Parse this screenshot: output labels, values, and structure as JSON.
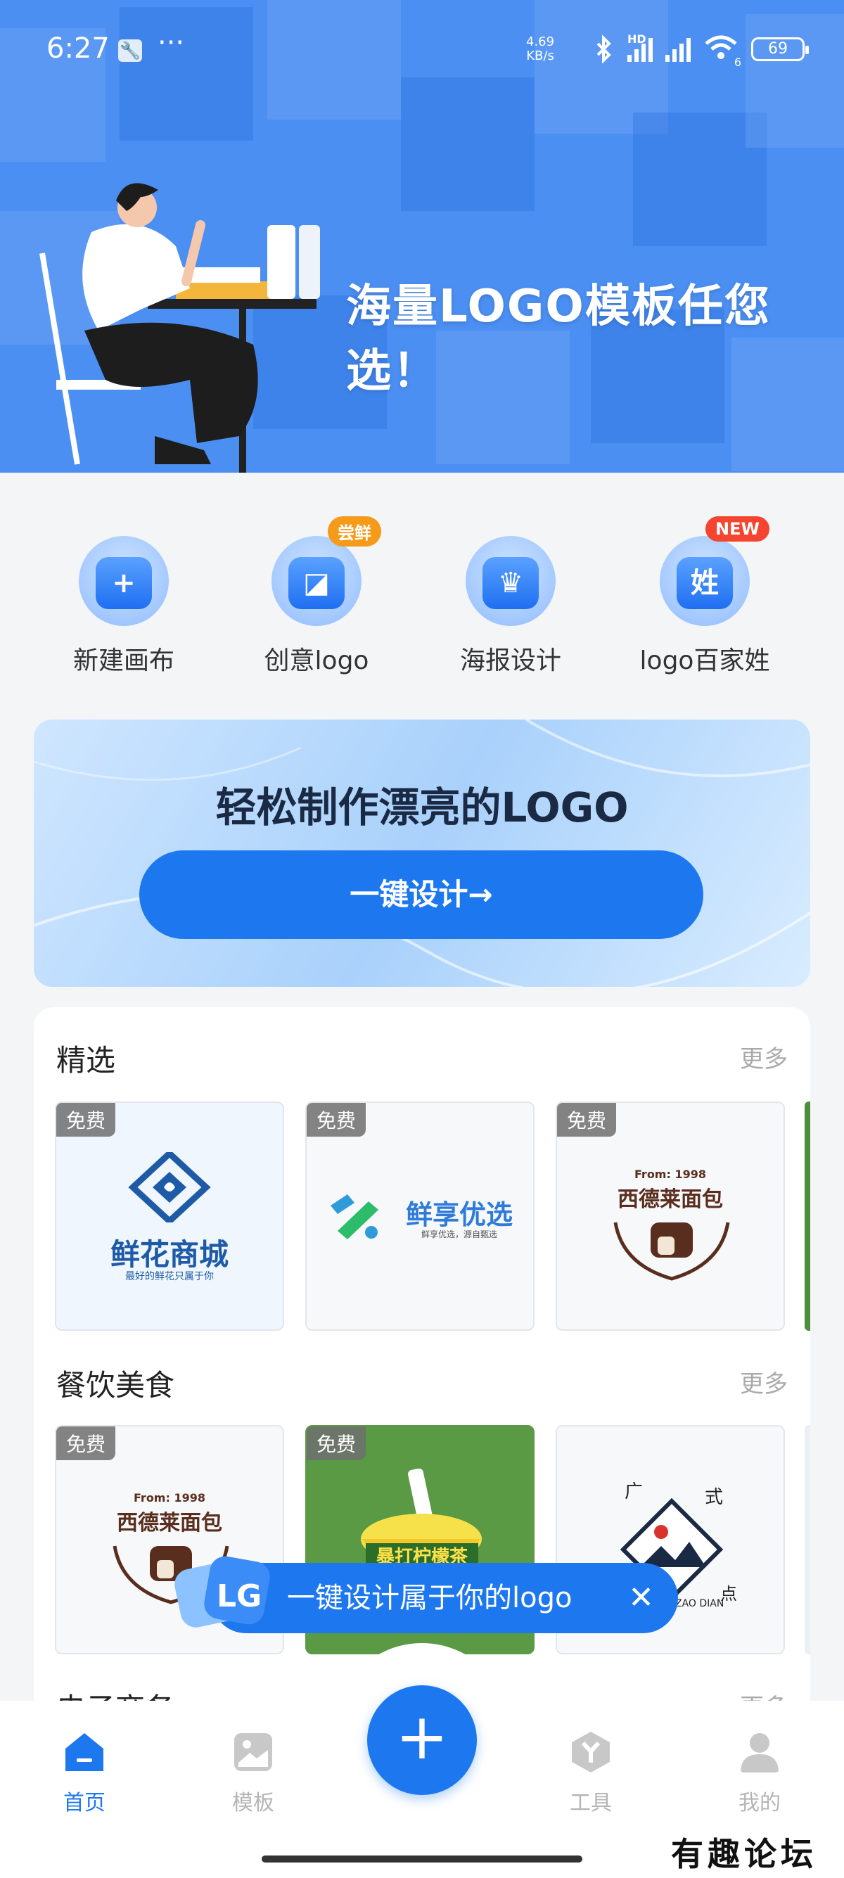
{
  "status_bar": {
    "time": "6:27",
    "speed_value": "4.69",
    "speed_unit": "KB/s",
    "hd_label": "HD",
    "wifi_label": "6",
    "battery": "69"
  },
  "hero": {
    "slogan": "海量LOGO模板任您选！"
  },
  "quick_actions": [
    {
      "label": "新建画布",
      "icon": "new-canvas-icon",
      "glyph": "+"
    },
    {
      "label": "创意logo",
      "icon": "creative-logo-icon",
      "glyph": "◪",
      "badge": "尝鲜",
      "badge_color": "#f59a19"
    },
    {
      "label": "海报设计",
      "icon": "poster-design-icon",
      "glyph": "♛"
    },
    {
      "label": "logo百家姓",
      "icon": "surname-logo-icon",
      "glyph": "姓",
      "badge": "NEW",
      "badge_color": "#f5442f"
    }
  ],
  "promo": {
    "title": "轻松制作漂亮的LOGO",
    "button": "一键设计→"
  },
  "sections": [
    {
      "title": "精选",
      "more": "更多",
      "cards": [
        {
          "tag": "免费",
          "logo_title": "鲜花商城",
          "logo_sub": "最好的鲜花只属于你"
        },
        {
          "tag": "免费",
          "logo_title": "鲜享优选",
          "logo_sub": "鲜享优选，源自甄选"
        },
        {
          "tag": "免费",
          "logo_title": "西德莱面包",
          "logo_sub": "From: 1998"
        }
      ]
    },
    {
      "title": "餐饮美食",
      "more": "更多",
      "cards": [
        {
          "tag": "免费",
          "logo_title": "西德莱面包",
          "logo_sub": "From: 1998"
        },
        {
          "tag": "免费",
          "logo_title": "暴打柠檬茶"
        },
        {
          "logo_title_left": "广",
          "logo_title_right": "式",
          "logo_corner": "点",
          "logo_sub": "ZAO DIAN"
        }
      ]
    },
    {
      "title": "电子商务",
      "more": "更多"
    }
  ],
  "toast": {
    "text": "一键设计属于你的logo",
    "close": "✕"
  },
  "tab_bar": {
    "items": [
      {
        "label": "首页",
        "active": true
      },
      {
        "label": "模板",
        "active": false
      },
      {
        "label": "工具",
        "active": false
      },
      {
        "label": "我的",
        "active": false
      }
    ],
    "fab": "+"
  },
  "watermark": "有趣论坛",
  "colors": {
    "primary": "#1d78f0",
    "hero_bg": "#4b8ff2",
    "tag_bg": "#6e6e6e",
    "tab_inactive": "#b5b5b5"
  }
}
